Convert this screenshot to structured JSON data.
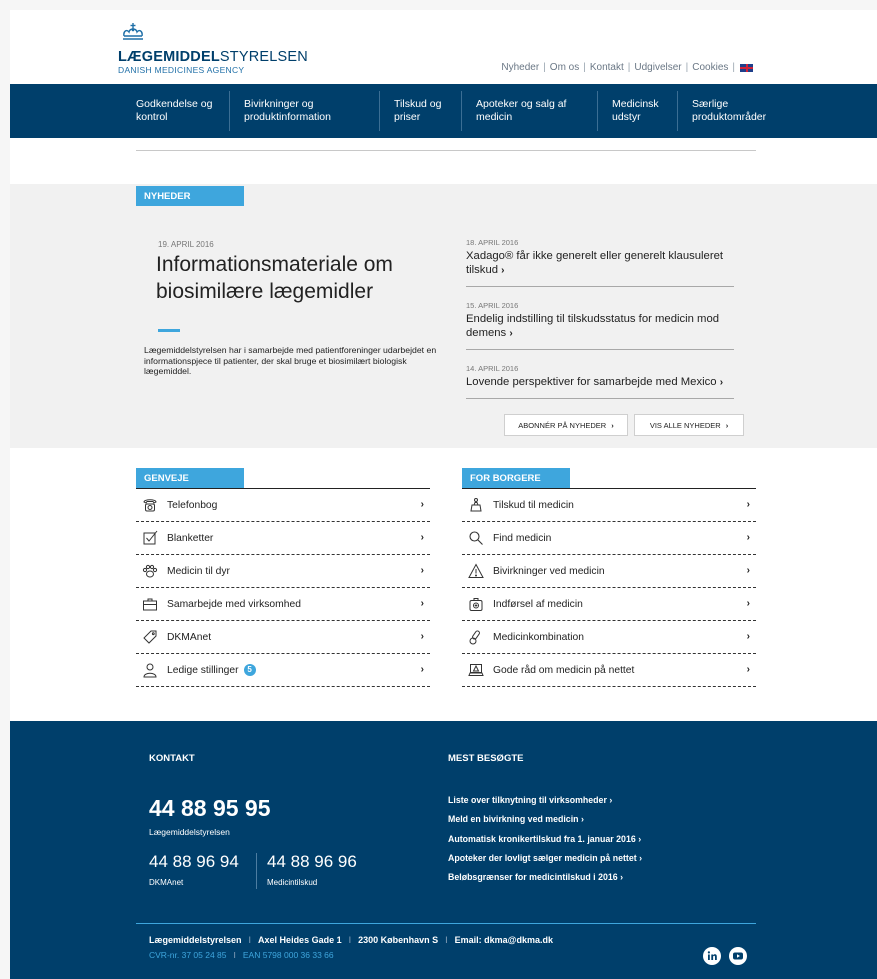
{
  "header": {
    "logo_title_bold": "LÆGEMIDDEL",
    "logo_title_thin": "STYRELSEN",
    "logo_subtitle": "DANISH MEDICINES AGENCY",
    "toplinks": [
      "Nyheder",
      "Om os",
      "Kontakt",
      "Udgivelser",
      "Cookies"
    ],
    "separator": "|"
  },
  "nav": {
    "items": [
      {
        "line1": "Godkendelse og",
        "line2": "kontrol"
      },
      {
        "line1": "Bivirkninger og",
        "line2": "produktinformation"
      },
      {
        "line1": "Tilskud og",
        "line2": "priser"
      },
      {
        "line1": "Apoteker og salg af",
        "line2": "medicin"
      },
      {
        "line1": "Medicinsk",
        "line2": "udstyr"
      },
      {
        "line1": "Særlige",
        "line2": "produktområder"
      }
    ]
  },
  "news": {
    "tag": "NYHEDER",
    "lead": {
      "date": "19. APRIL 2016",
      "title": "Informationsmateriale om biosimilære lægemidler",
      "text": "Lægemiddelstyrelsen har i samarbejde med patientforeninger udarbejdet en informationspjece til patienter, der skal bruge et biosimilært biologisk lægemiddel."
    },
    "items": [
      {
        "date": "18. APRIL 2016",
        "title": "Xadago® får ikke generelt eller generelt klausuleret tilskud"
      },
      {
        "date": "15. APRIL 2016",
        "title": "Endelig indstilling til tilskudsstatus for medicin mod demens"
      },
      {
        "date": "14. APRIL 2016",
        "title": "Lovende perspektiver for samarbejde med Mexico"
      }
    ],
    "arrow": "›",
    "subscribe_label": "ABONNÉR PÅ NYHEDER",
    "all_label": "VIS ALLE NYHEDER"
  },
  "genveje": {
    "tag": "GENVEJE",
    "items": [
      {
        "label": "Telefonbog",
        "icon": "phone-icon"
      },
      {
        "label": "Blanketter",
        "icon": "checkbox-icon"
      },
      {
        "label": "Medicin til dyr",
        "icon": "paw-icon"
      },
      {
        "label": "Samarbejde med virksomhed",
        "icon": "briefcase-icon"
      },
      {
        "label": "DKMAnet",
        "icon": "tag-icon"
      },
      {
        "label": "Ledige stillinger",
        "icon": "person-icon",
        "badge": "5"
      }
    ]
  },
  "borgere": {
    "tag": "FOR BORGERE",
    "items": [
      {
        "label": "Tilskud til medicin",
        "icon": "piggybank-icon"
      },
      {
        "label": "Find medicin",
        "icon": "search-icon"
      },
      {
        "label": "Bivirkninger ved medicin",
        "icon": "warning-icon"
      },
      {
        "label": "Indførsel af medicin",
        "icon": "suitcase-icon"
      },
      {
        "label": "Medicinkombination",
        "icon": "pills-icon"
      },
      {
        "label": "Gode råd om medicin på nettet",
        "icon": "laptop-warning-icon"
      }
    ]
  },
  "footer": {
    "kontakt_heading": "KONTAKT",
    "main_phone": "44 88 95 95",
    "main_phone_label": "Lægemiddelstyrelsen",
    "phone2": "44 88 96 94",
    "phone2_label": "DKMAnet",
    "phone3": "44 88 96 96",
    "phone3_label": "Medicintilskud",
    "mest_heading": "MEST BESØGTE",
    "links": [
      "Liste over tilknytning til virksomheder",
      "Meld en bivirkning ved medicin",
      "Automatisk kronikertilskud fra 1. januar 2016",
      "Apoteker der lovligt sælger medicin på nettet",
      "Beløbsgrænser for medicintilskud i 2016"
    ],
    "address": [
      "Lægemiddelstyrelsen",
      "Axel Heides Gade 1",
      "2300 København S",
      "Email: dkma@dkma.dk"
    ],
    "ids": [
      "CVR-nr. 37 05 24 85",
      "EAN 5798 000 36 33 66"
    ],
    "separator": "I"
  },
  "colors": {
    "primary": "#003f6b",
    "accent": "#3ea6dd",
    "news_bg": "#f1f1f1"
  }
}
